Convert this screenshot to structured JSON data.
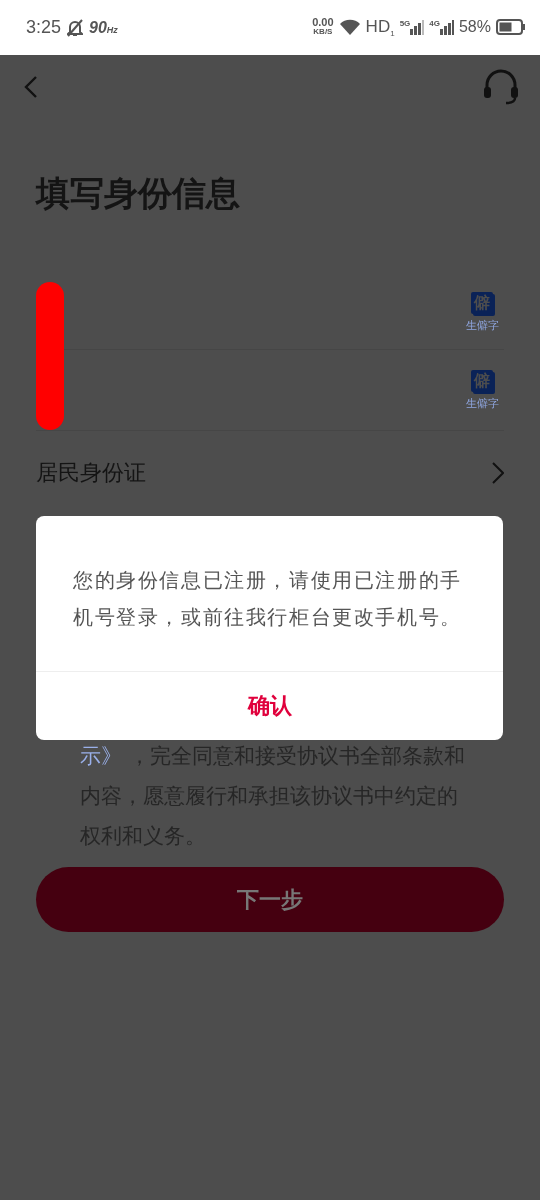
{
  "status_bar": {
    "time": "3:25",
    "refresh_rate": "90",
    "refresh_unit": "Hz",
    "speed": "0.00",
    "speed_unit": "KB/S",
    "hd": "HD",
    "hd_sub": "1",
    "sim1": "5G",
    "sim2": "4G",
    "battery": "58%"
  },
  "title": "填写身份信息",
  "name_fields": [
    {
      "rare_char_icon": "僻",
      "rare_char_label": "生僻字"
    },
    {
      "rare_char_icon": "僻",
      "rare_char_label": "生僻字"
    }
  ],
  "id_type": "居民身份证",
  "agreement": {
    "link": "示》",
    "text": " ，完全同意和接受协议书全部条款和内容，愿意履行和承担该协议书中约定的权利和义务。"
  },
  "next_button": {
    "label": "下一步",
    "disabled": true
  },
  "dialog": {
    "message": "您的身份信息已注册，请使用已注册的手机号登录，或前往我行柜台更改手机号。",
    "confirm": "确认"
  }
}
